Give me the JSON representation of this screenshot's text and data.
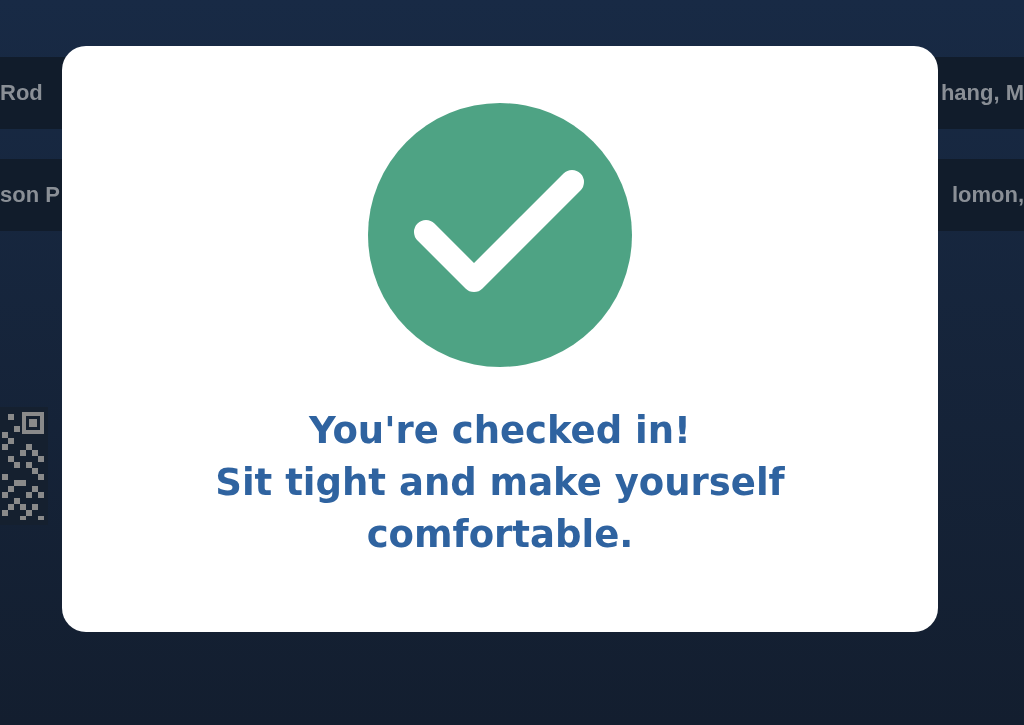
{
  "background": {
    "rows": [
      {
        "left_text": "Rod",
        "right_text": "hang, M"
      },
      {
        "left_text": "son P",
        "right_text": "lomon,"
      }
    ]
  },
  "dialog": {
    "heading": "You're checked in!",
    "message": "Sit tight and make yourself comfortable."
  }
}
